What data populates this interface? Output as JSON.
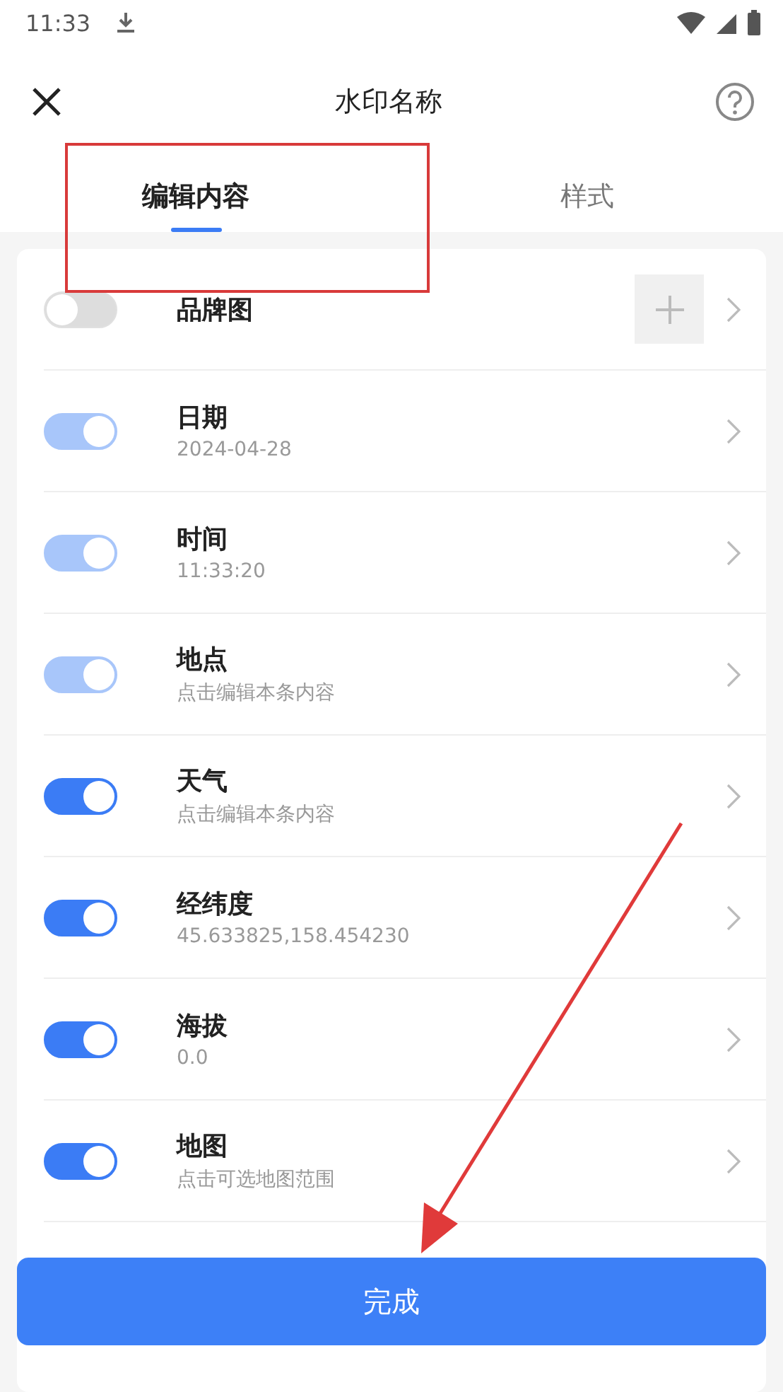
{
  "status_bar": {
    "time": "11:33"
  },
  "header": {
    "title": "水印名称"
  },
  "tabs": [
    {
      "label": "编辑内容",
      "selected": true
    },
    {
      "label": "样式",
      "selected": false
    }
  ],
  "items": [
    {
      "kind": "image",
      "title": "品牌图",
      "on": false,
      "disabled": false
    },
    {
      "kind": "text",
      "title": "日期",
      "subtitle": "2024-04-28",
      "on": true,
      "disabled": true
    },
    {
      "kind": "text",
      "title": "时间",
      "subtitle": "11:33:20",
      "on": true,
      "disabled": true
    },
    {
      "kind": "text",
      "title": "地点",
      "subtitle": "点击编辑本条内容",
      "on": true,
      "disabled": true
    },
    {
      "kind": "text",
      "title": "天气",
      "subtitle": "点击编辑本条内容",
      "on": true,
      "disabled": false
    },
    {
      "kind": "text",
      "title": "经纬度",
      "subtitle": "45.633825,158.454230",
      "on": true,
      "disabled": false
    },
    {
      "kind": "text",
      "title": "海拔",
      "subtitle": "0.0",
      "on": true,
      "disabled": false
    },
    {
      "kind": "text",
      "title": "地图",
      "subtitle": "点击可选地图范围",
      "on": true,
      "disabled": false
    }
  ],
  "done_button": {
    "label": "完成"
  }
}
